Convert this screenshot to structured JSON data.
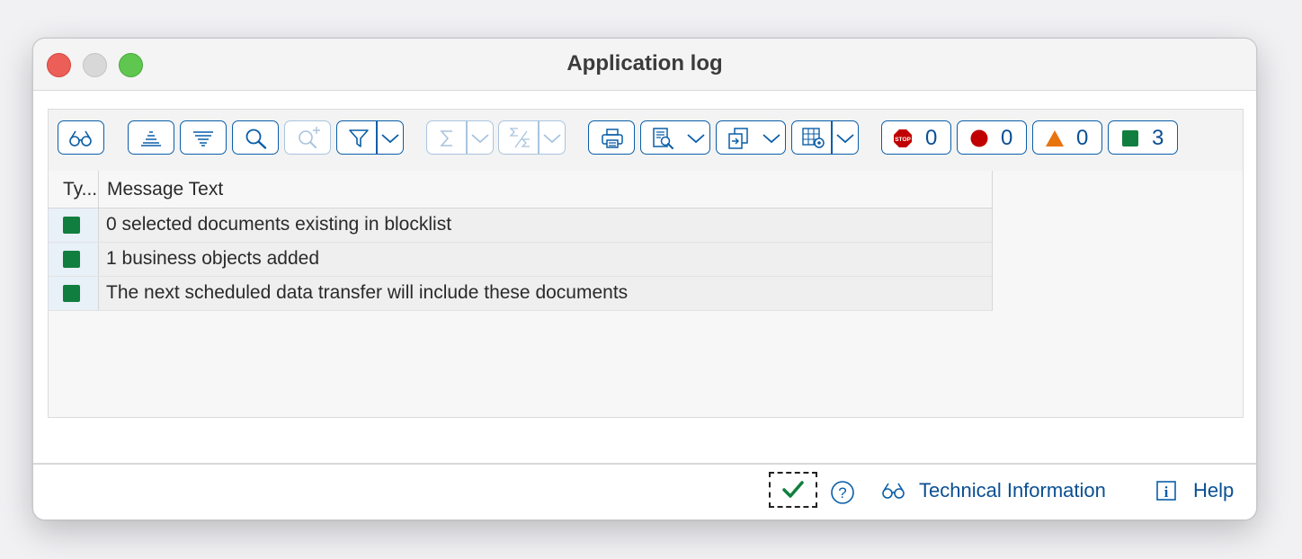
{
  "window": {
    "title": "Application log"
  },
  "toolbar": {
    "counts": {
      "error_stop": "0",
      "error": "0",
      "warning": "0",
      "success": "3"
    }
  },
  "grid": {
    "columns": {
      "type": "Ty...",
      "message": "Message Text"
    },
    "rows": [
      {
        "type": "success",
        "message": "0 selected documents existing in blocklist"
      },
      {
        "type": "success",
        "message": "1 business objects added"
      },
      {
        "type": "success",
        "message": "The next scheduled data transfer will include these documents"
      }
    ]
  },
  "footer": {
    "technical_information": "Technical Information",
    "help": "Help"
  },
  "colors": {
    "accent": "#0a5ea8",
    "success": "#107e3e",
    "error": "#c00000",
    "warning": "#e9730c"
  }
}
